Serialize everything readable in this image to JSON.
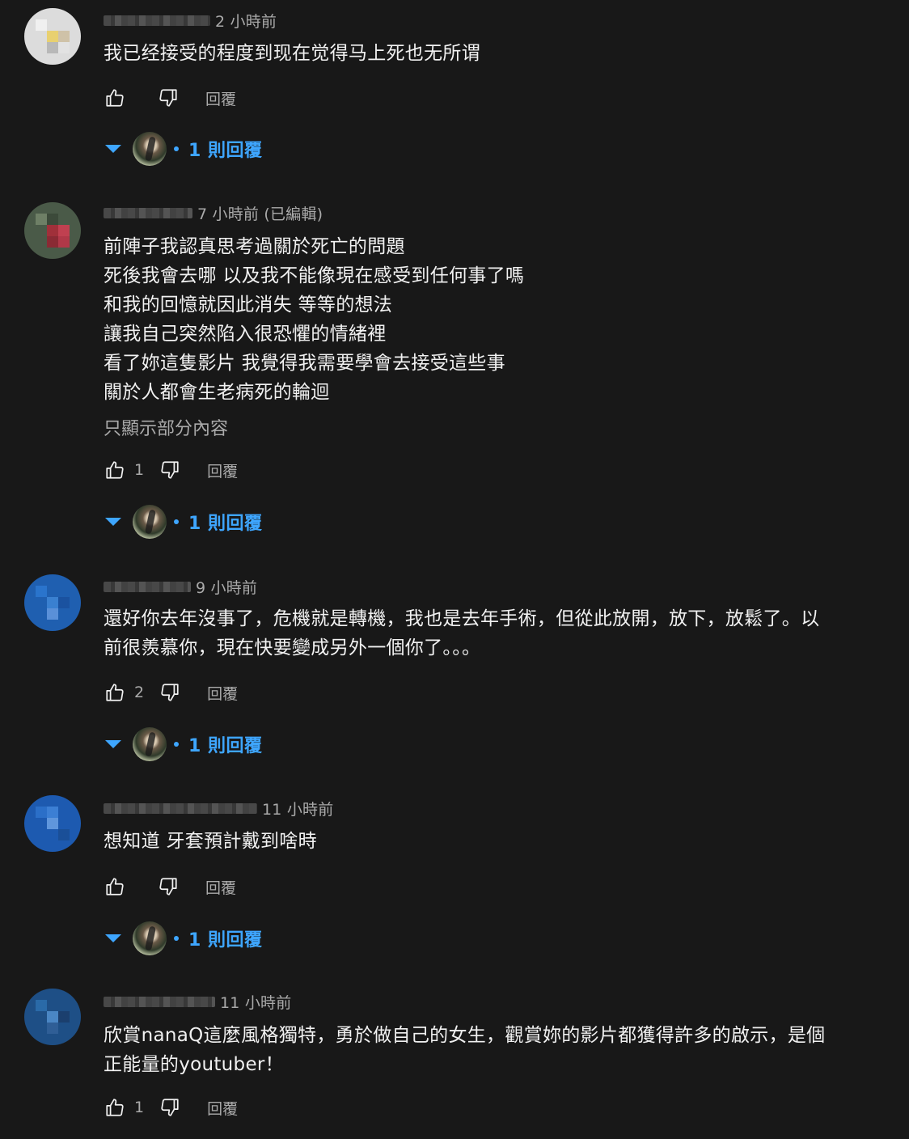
{
  "comments": [
    {
      "time": "2 小時前",
      "lines": "我已经接受的程度到现在觉得马上死也无所谓",
      "like_count": "",
      "reply_label": "回覆",
      "replies_label": "1 則回覆"
    },
    {
      "time": "7 小時前 (已編輯)",
      "lines": "前陣子我認真思考過關於死亡的問題\n死後我會去哪 以及我不能像現在感受到任何事了嗎\n和我的回憶就因此消失 等等的想法\n讓我自己突然陷入很恐懼的情緒裡\n看了妳這隻影片 我覺得我需要學會去接受這些事\n關於人都會生老病死的輪迴",
      "show_less": "只顯示部分內容",
      "like_count": "1",
      "reply_label": "回覆",
      "replies_label": "1 則回覆"
    },
    {
      "time": "9 小時前",
      "lines": "還好你去年沒事了，危機就是轉機，我也是去年手術，但從此放開，放下，放鬆了。以\n前很羨慕你，現在快要變成另外一個你了。。。",
      "like_count": "2",
      "reply_label": "回覆",
      "replies_label": "1 則回覆"
    },
    {
      "time": "11 小時前",
      "lines": "想知道 牙套預計戴到啥時",
      "like_count": "",
      "reply_label": "回覆",
      "replies_label": "1 則回覆"
    },
    {
      "time": "11 小時前",
      "lines": "欣賞nanaQ這麼風格獨特，勇於做自己的女生，觀賞妳的影片都獲得許多的啟示，是個\n正能量的youtuber！",
      "like_count": "1",
      "reply_label": "回覆"
    }
  ],
  "icons": {
    "like": "thumb-up-icon",
    "dislike": "thumb-down-icon",
    "expand": "caret-down-icon"
  },
  "colors": {
    "background": "#181818",
    "link": "#3ea6ff",
    "muted": "#aaaaaa",
    "text": "#f1f1f1"
  }
}
